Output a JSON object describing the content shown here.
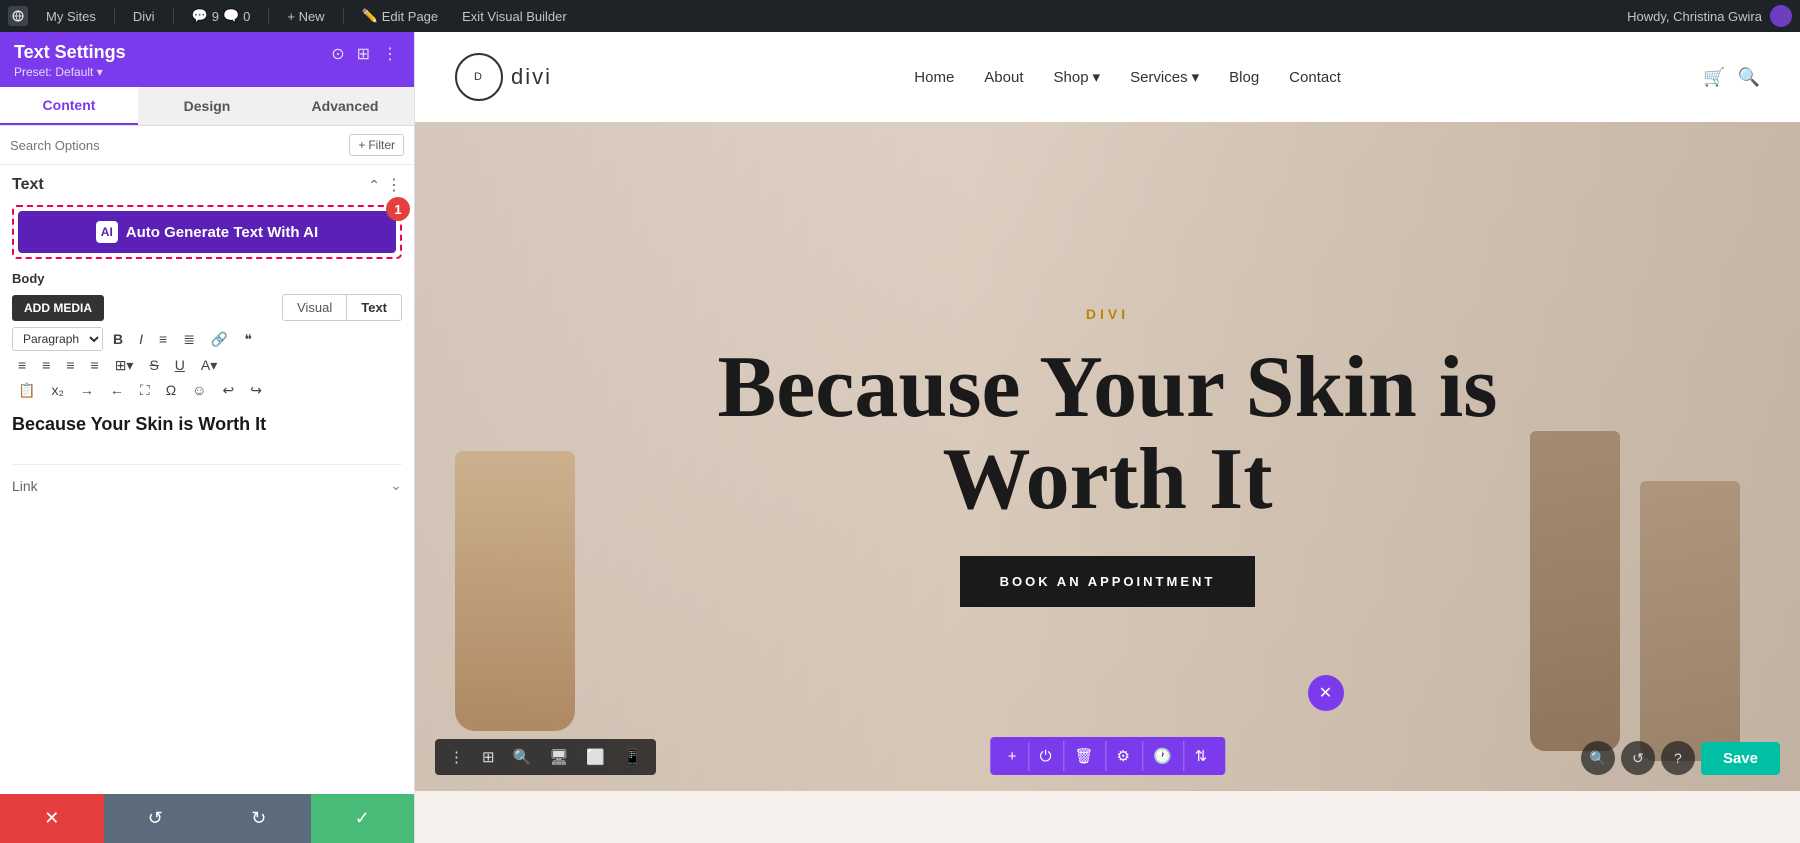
{
  "adminBar": {
    "wordpressIcon": "W",
    "mySites": "My Sites",
    "divi": "Divi",
    "comments": "9",
    "commentCount": "0",
    "new": "+ New",
    "editPage": "Edit Page",
    "exitVisualBuilder": "Exit Visual Builder",
    "howdy": "Howdy, Christina Gwira"
  },
  "sidebar": {
    "title": "Text Settings",
    "preset": "Preset: Default ▾",
    "tabs": {
      "content": "Content",
      "design": "Design",
      "advanced": "Advanced"
    },
    "searchPlaceholder": "Search Options",
    "filterLabel": "+ Filter",
    "sectionTitle": "Text",
    "aiButton": "Auto Generate Text With AI",
    "aiIcon": "AI",
    "badge": "1",
    "bodyLabel": "Body",
    "addMedia": "ADD MEDIA",
    "visualTab": "Visual",
    "textTab": "Text",
    "paragraphSelect": "Paragraph",
    "editorContent": "Because Your Skin is Worth It",
    "linkLabel": "Link"
  },
  "website": {
    "logoText": "divi",
    "logoInner": "D",
    "nav": {
      "home": "Home",
      "about": "About",
      "shop": "Shop",
      "services": "Services",
      "blog": "Blog",
      "contact": "Contact"
    },
    "hero": {
      "brand": "DIVI",
      "title": "Because Your Skin is Worth It",
      "cta": "BOOK AN APPOINTMENT"
    }
  },
  "toolbar": {
    "save": "Save"
  }
}
